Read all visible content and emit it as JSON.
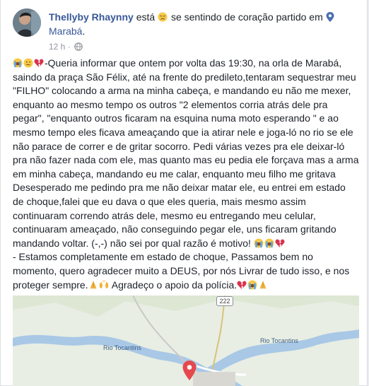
{
  "post": {
    "author": "Thellyby Rhaynny",
    "status_pre": " está ",
    "status_post": " se sentindo de coração partido em ",
    "location": "Marabá",
    "location_period": ".",
    "time": "12 h",
    "time_sep": " · "
  },
  "body": {
    "paragraph1": "-Queria informar que ontem por volta das 19:30, na orla de Marabá, saindo da praça São Félix, até na frente do predileto,tentaram sequestrar meu \"FILHO\" colocando a arma na minha cabeça, e mandando eu não me mexer, enquanto ao mesmo tempo os outros \"2 elementos corria atrás dele pra pegar\", \"enquanto outros ficaram na esquina numa moto esperando \" e ao mesmo tempo eles ficava ameaçando que ia atirar nele e joga-ló no rio se ele não parace de correr e de gritar socorro. Pedi várias vezes pra ele deixar-ló pra não fazer nada com ele, mas quanto mas eu pedia ele forçava mas a arma em minha cabeça, mandando eu me calar, enquanto meu filho me gritava Desesperado me pedindo pra me não deixar matar ele, eu entrei em estado de choque,falei que eu dava o que eles queria, mais mesmo assim continuaram correndo atrás dele, mesmo eu entregando meu celular, continuaram ameaçado, não conseguindo pegar ele, uns ficaram gritando mandando voltar. (-,-) não sei por qual razão é motivo! ",
    "paragraph2": "- Estamos completamente em estado de choque, Passamos bem no momento, quero agradecer muito a DEUS, por nós Livrar de tudo isso, e nos proteger sempre.",
    "paragraph2b": " Agradeço o apoio da polícia."
  },
  "map": {
    "road_number": "222",
    "river_label_1": "Rio Tocantins",
    "river_label_2": "Rio Tocantins"
  },
  "icons": {
    "feeling": "disappointed-face-emoji",
    "location": "map-pin-icon",
    "privacy": "globe-icon"
  },
  "colors": {
    "link": "#385898",
    "text": "#1d2129",
    "meta": "#90949c",
    "river": "#a9c8e6",
    "pin": "#e5494d"
  }
}
